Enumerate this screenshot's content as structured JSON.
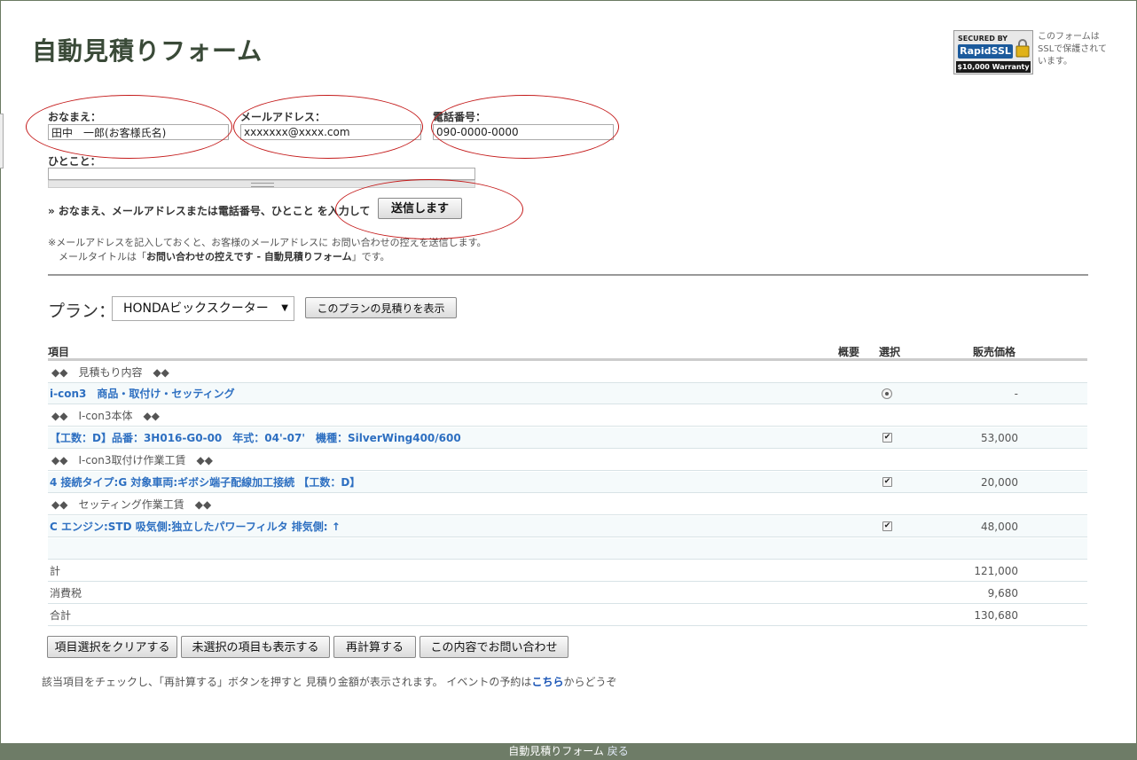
{
  "page": {
    "title": "自動見積りフォーム"
  },
  "ssl": {
    "badge_top": "SECURED BY",
    "badge_brand": "RapidSSL",
    "badge_warranty": "$10,000 Warranty",
    "note": "このフォームはSSLで保護されています。"
  },
  "form": {
    "name_label": "おなまえ：",
    "name_value": "田中　一郎(お客様氏名)",
    "email_label": "メールアドレス：",
    "email_value": "xxxxxxx@xxxx.com",
    "phone_label": "電話番号：",
    "phone_value": "090-0000-0000",
    "comment_label": "ひとこと：",
    "instruction": "» おなまえ、メールアドレスまたは電話番号、ひとこと を入力して",
    "submit_label": "送信します",
    "note_line1": "※メールアドレスを記入しておくと、お客様のメールアドレスに お問い合わせの控えを送信します。",
    "note_line2_prefix": "メールタイトルは「",
    "note_line2_bold": "お問い合わせの控えです - 自動見積りフォーム",
    "note_line2_suffix": "」です。"
  },
  "plan": {
    "label": "プラン：",
    "selected": "HONDAビックスクーター",
    "show_button": "このプランの見積りを表示"
  },
  "table": {
    "headers": {
      "item": "項目",
      "summary": "概要",
      "select": "選択",
      "price": "販売価格"
    },
    "rows": [
      {
        "type": "category",
        "text": "◆◆　見積もり内容　◆◆"
      },
      {
        "type": "item",
        "text": "i-con3　商品・取付け・セッティング",
        "control": "radio",
        "checked": true,
        "price": "-"
      },
      {
        "type": "category",
        "text": "◆◆　I-con3本体　◆◆"
      },
      {
        "type": "item",
        "text": "【工数：D】品番：3H016-G0-00　年式：04'-07'　機種：SilverWing400/600",
        "control": "checkbox",
        "checked": true,
        "price": "53,000"
      },
      {
        "type": "category",
        "text": "◆◆　I-con3取付け作業工賃　◆◆"
      },
      {
        "type": "item",
        "text": "4 接続タイプ:G 対象車両:ギボシ端子配線加工接続 【工数：D】",
        "control": "checkbox",
        "checked": true,
        "price": "20,000"
      },
      {
        "type": "category",
        "text": "◆◆　セッティング作業工賃　◆◆"
      },
      {
        "type": "item",
        "text": "C エンジン:STD 吸気側:独立したパワーフィルタ 排気側: ↑",
        "control": "checkbox",
        "checked": true,
        "price": "48,000"
      },
      {
        "type": "blank",
        "text": ""
      },
      {
        "type": "total",
        "text": "計",
        "price": "121,000"
      },
      {
        "type": "total",
        "text": "消費税",
        "price": "9,680"
      },
      {
        "type": "total",
        "text": "合計",
        "price": "130,680"
      }
    ]
  },
  "buttons": {
    "clear": "項目選択をクリアする",
    "show_unselected": "未選択の項目も表示する",
    "recalc": "再計算する",
    "inquire": "この内容でお問い合わせ"
  },
  "footer": {
    "note_prefix": "該当項目をチェックし、「再計算する」ボタンを押すと 見積り金額が表示されます。 イベントの予約は",
    "note_link": "こちら",
    "note_suffix": "からどうぞ",
    "bar_text": "自動見積りフォーム",
    "bar_back": "戻る"
  },
  "colors": {
    "annotation": "#c41a1a",
    "link": "#2d6fc1",
    "footer_bar": "#6e7c67"
  }
}
